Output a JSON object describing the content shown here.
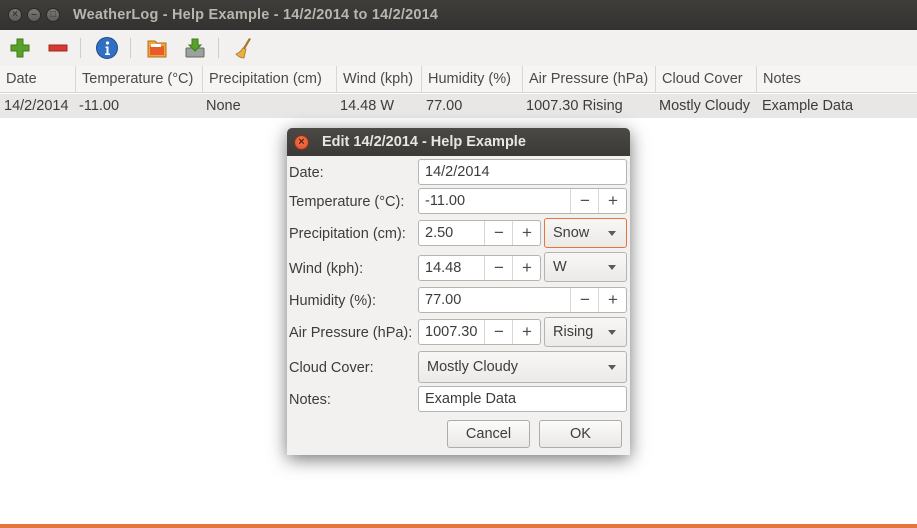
{
  "window": {
    "title": "WeatherLog - Help Example - 14/2/2014 to 14/2/2014"
  },
  "toolbar": {
    "icons": [
      "add-icon",
      "remove-icon",
      "info-icon",
      "import-icon",
      "export-icon",
      "clear-icon"
    ]
  },
  "table": {
    "columns": [
      "Date",
      "Temperature (°C)",
      "Precipitation (cm)",
      "Wind (kph)",
      "Humidity (%)",
      "Air Pressure (hPa)",
      "Cloud Cover",
      "Notes"
    ],
    "rows": [
      [
        "14/2/2014",
        "-11.00",
        "None",
        "14.48 W",
        "77.00",
        "1007.30 Rising",
        "Mostly Cloudy",
        "Example Data"
      ]
    ]
  },
  "dialog": {
    "title": "Edit 14/2/2014 - Help Example",
    "date_label": "Date:",
    "date_value": "14/2/2014",
    "temp_label": "Temperature (°C):",
    "temp_value": "-11.00",
    "prec_label": "Precipitation (cm):",
    "prec_value": "2.50",
    "prec_type": "Snow",
    "wind_label": "Wind (kph):",
    "wind_value": "14.48",
    "wind_dir": "W",
    "hum_label": "Humidity (%):",
    "hum_value": "77.00",
    "press_label": "Air Pressure (hPa):",
    "press_value": "1007.30",
    "press_change": "Rising",
    "cloud_label": "Cloud Cover:",
    "cloud_value": "Mostly Cloudy",
    "notes_label": "Notes:",
    "notes_value": "Example Data",
    "minus": "−",
    "plus": "+",
    "cancel": "Cancel",
    "ok": "OK"
  },
  "colors": {
    "accent": "#e6743e",
    "close": "#e25a31"
  }
}
